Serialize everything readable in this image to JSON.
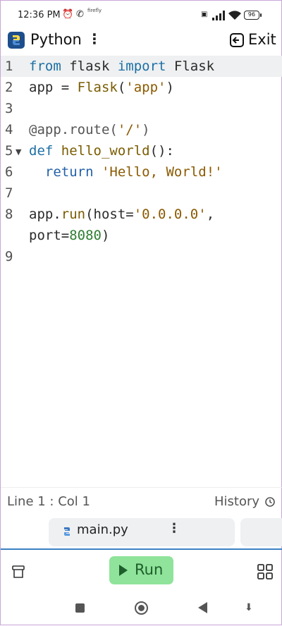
{
  "status_bar": {
    "time": "12:36 PM",
    "alarm_icon": "alarm-clock-icon",
    "whatsapp_icon": "whatsapp-icon",
    "app_label": "firefly",
    "battery": "96"
  },
  "header": {
    "title": "Python",
    "menu_glyph": "⋮",
    "exit_label": "Exit"
  },
  "code_lines": [
    {
      "number": "1",
      "text": "from flask import Flask"
    },
    {
      "number": "2",
      "text": "app = Flask('app')"
    },
    {
      "number": "3",
      "text": ""
    },
    {
      "number": "4",
      "text": "@app.route('/')"
    },
    {
      "number": "5",
      "text": "def hello_world():"
    },
    {
      "number": "6",
      "text": "  return 'Hello, World!'"
    },
    {
      "number": "7",
      "text": ""
    },
    {
      "number": "8",
      "text": "app.run(host='0.0.0.0',"
    },
    {
      "number": "",
      "text": "port=8080)"
    },
    {
      "number": "9",
      "text": ""
    }
  ],
  "editor_status": {
    "cursor_position": "Line 1 : Col 1",
    "history_label": "History"
  },
  "tabs": [
    {
      "label": "main.py",
      "more_glyph": "⋮"
    }
  ],
  "toolbar": {
    "run_label": "Run"
  },
  "colors": {
    "run_button": "#8fe39a",
    "accent_divider": "#3b82c4",
    "keyword": "#1d6fa5",
    "string": "#8b5a00",
    "number": "#2f7d32"
  }
}
